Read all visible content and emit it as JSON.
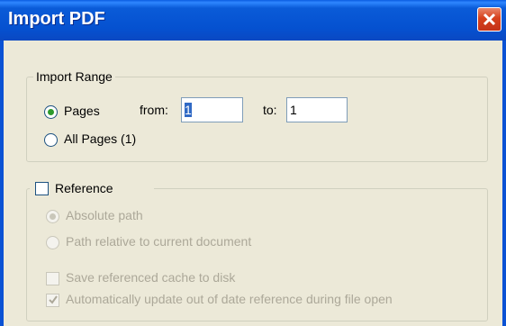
{
  "window": {
    "title": "Import PDF",
    "close_icon": "close-icon"
  },
  "import_range": {
    "legend": "Import Range",
    "pages_label": "Pages",
    "from_label": "from:",
    "from_value": "1",
    "to_label": "to:",
    "to_value": "1",
    "all_pages_label": "All Pages (1)",
    "selected": "Pages"
  },
  "reference": {
    "checkbox_label": "Reference",
    "checked": false,
    "absolute_path_label": "Absolute path",
    "relative_path_label": "Path relative to current document",
    "save_cache_label": "Save referenced cache to disk",
    "auto_update_label": "Automatically update out of date reference during file open"
  },
  "colors": {
    "title_bar": "#0a5ce0",
    "background": "#ece9d8",
    "close_button": "#d6401c",
    "disabled_text": "#aca899"
  }
}
